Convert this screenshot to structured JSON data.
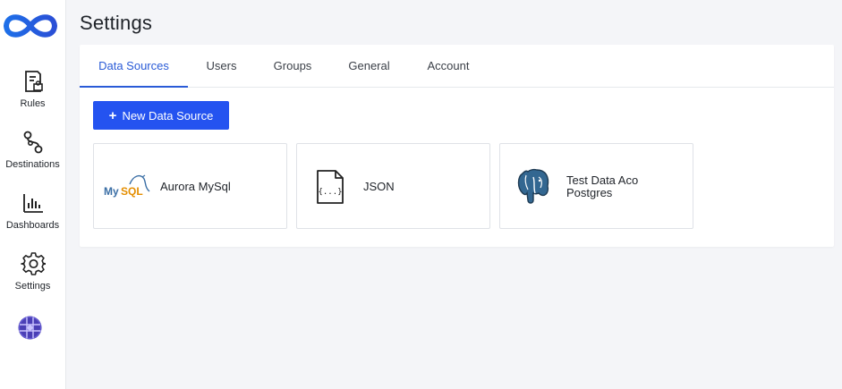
{
  "sidebar": {
    "items": [
      {
        "label": "Rules",
        "icon": "rules-icon"
      },
      {
        "label": "Destinations",
        "icon": "destinations-icon"
      },
      {
        "label": "Dashboards",
        "icon": "dashboards-icon"
      },
      {
        "label": "Settings",
        "icon": "gear-icon"
      }
    ],
    "logo": "infinity-logo-icon",
    "avatar": "globe-avatar-icon"
  },
  "page": {
    "title": "Settings"
  },
  "tabs": [
    {
      "label": "Data Sources",
      "active": true
    },
    {
      "label": "Users"
    },
    {
      "label": "Groups"
    },
    {
      "label": "General"
    },
    {
      "label": "Account"
    }
  ],
  "toolbar": {
    "new_data_source_label": "New Data Source"
  },
  "data_sources": [
    {
      "name": "Aurora MySql",
      "icon": "mysql-logo-icon"
    },
    {
      "name": "JSON",
      "icon": "json-file-icon"
    },
    {
      "name_line1": "Test Data Aco",
      "name_line2": "Postgres",
      "icon": "postgres-elephant-icon"
    }
  ],
  "colors": {
    "accent": "#2453f0",
    "active_tab": "#2a5bd7",
    "background": "#f4f5f8"
  }
}
